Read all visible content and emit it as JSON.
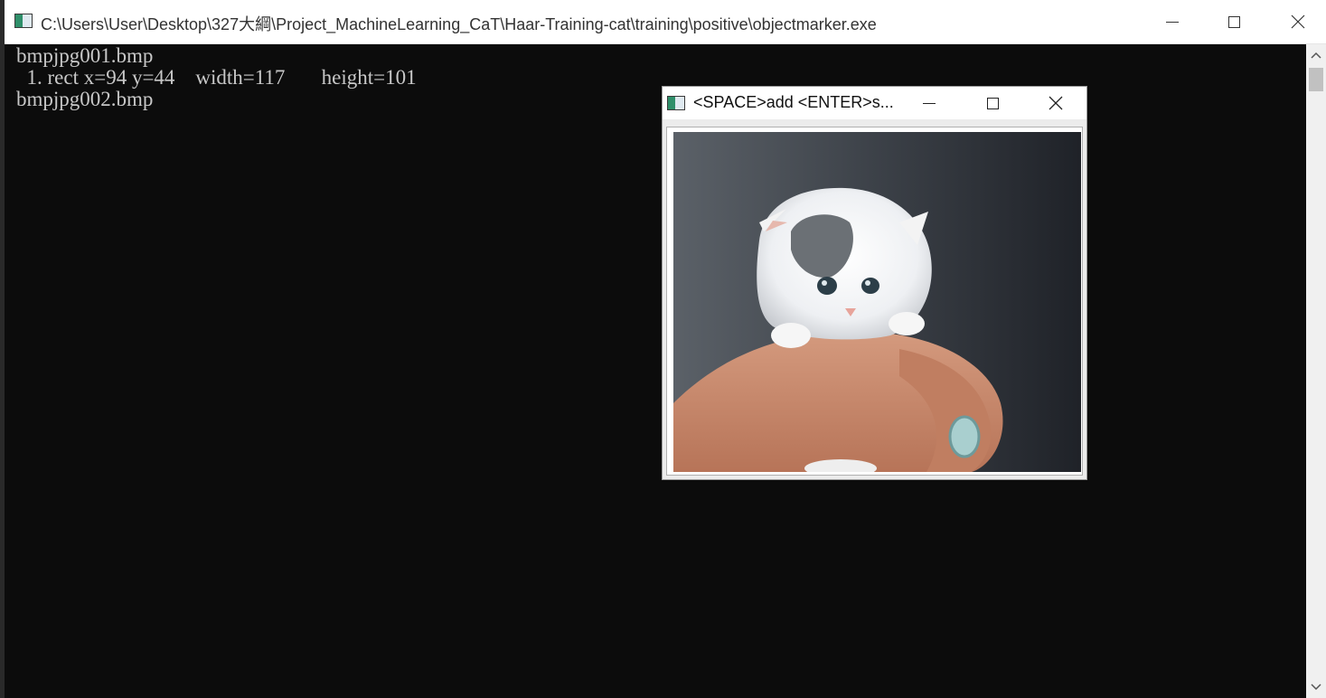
{
  "console_window": {
    "title": "C:\\Users\\User\\Desktop\\327大綱\\Project_MachineLearning_CaT\\Haar-Training-cat\\training\\positive\\objectmarker.exe",
    "lines": [
      "bmpjpg001.bmp",
      "  1. rect x=94 y=44    width=117       height=101",
      "bmpjpg002.bmp"
    ],
    "background_color": "#0c0c0c",
    "text_color": "#c8c8c8"
  },
  "popup_window": {
    "title": "<SPACE>add <ENTER>s...",
    "image_alt": "kitten held in hand"
  },
  "icons": {
    "minimize": "minimize-icon",
    "maximize": "maximize-icon",
    "close": "close-icon",
    "app": "console-app-icon"
  }
}
